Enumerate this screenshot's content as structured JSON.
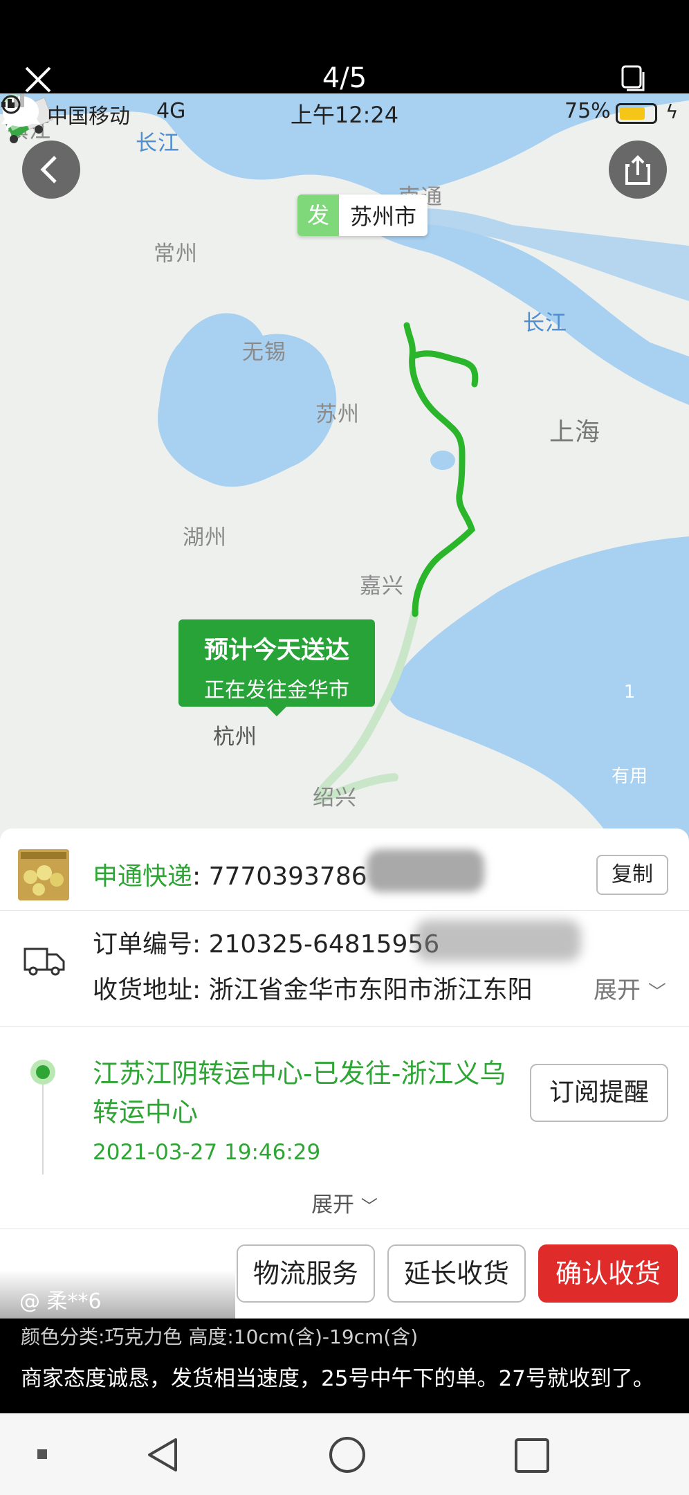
{
  "viewer": {
    "counter": "4/5"
  },
  "status_bar": {
    "carrier": "中国移动",
    "network": "4G",
    "time": "上午12:24",
    "battery": "75%",
    "battery_level": 0.75
  },
  "map": {
    "labels": {
      "zhenjiang": "镇江",
      "changjiang_top": "长江",
      "nantong": "南通",
      "changzhou": "常州",
      "changjiang_right": "长江",
      "wuxi": "无锡",
      "suzhou": "苏州",
      "shanghai": "上海",
      "huzhou": "湖州",
      "jiaxing": "嘉兴",
      "hangzhou": "杭州",
      "shaoxing": "绍兴"
    },
    "origin": {
      "tag": "发",
      "city": "苏州市"
    },
    "eta": {
      "title": "预计今天送达",
      "subtitle": "正在发往金华市"
    },
    "comment_count": "1",
    "useful_label": "有用",
    "route_color": "#2ab52a",
    "route_pending_color": "#c9e6c9",
    "water_color": "#a8d0f0"
  },
  "shipment": {
    "courier_name": "申通快递",
    "tracking_number": ": 7770393786",
    "copy_label": "复制",
    "order_number": "订单编号: 210325-64815956",
    "address": "收货地址: 浙江省金华市东阳市浙江东阳",
    "address_expand": "展开",
    "latest_status": "江苏江阴转运中心-已发往-浙江义乌转运中心",
    "latest_time": "2021-03-27 19:46:29",
    "subscribe_label": "订阅提醒",
    "expand_label": "展开"
  },
  "actions": {
    "logistics": "物流服务",
    "extend": "延长收货",
    "confirm": "确认收货",
    "confirm_color": "#e02b2b"
  },
  "review": {
    "author": "@ 柔**6",
    "spec": "颜色分类:巧克力色 高度:10cm(含)-19cm(含)",
    "text": "商家态度诚恳，发货相当速度，25号中午下的单。27号就收到了。"
  }
}
